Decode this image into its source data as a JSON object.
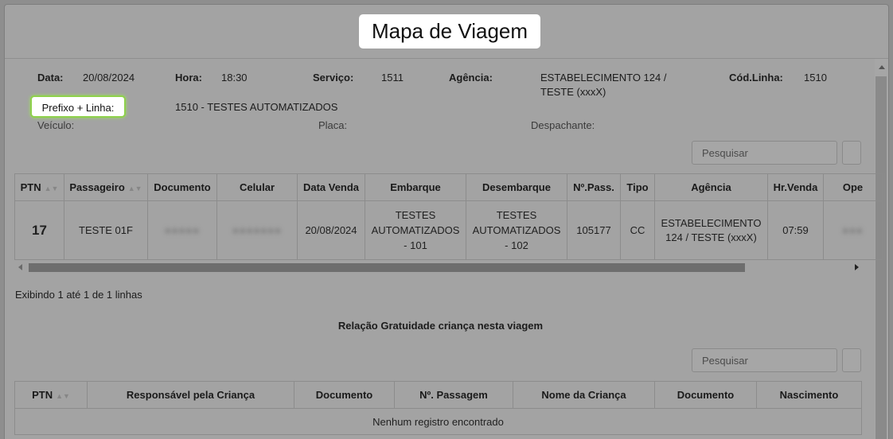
{
  "modal": {
    "title": "Mapa de Viagem"
  },
  "info": {
    "data_label": "Data:",
    "data_value": "20/08/2024",
    "hora_label": "Hora:",
    "hora_value": "18:30",
    "servico_label": "Serviço:",
    "servico_value": "1511",
    "agencia_label": "Agência:",
    "agencia_value_line1": "ESTABELECIMENTO 124 /",
    "agencia_value_line2": "TESTE (xxxX)",
    "codlinha_label": "Cód.Linha:",
    "codlinha_value": "1510",
    "prefixo_label": "Prefixo + Linha:",
    "prefixo_value": "1510 - TESTES AUTOMATIZADOS",
    "veiculo_label": "Veículo:",
    "placa_label": "Placa:",
    "despachante_label": "Despachante:"
  },
  "search": {
    "placeholder": "Pesquisar"
  },
  "passengers": {
    "headers": [
      "PTN",
      "Passageiro",
      "Documento",
      "Celular",
      "Data Venda",
      "Embarque",
      "Desembarque",
      "Nº.Pass.",
      "Tipo",
      "Agência",
      "Hr.Venda",
      "Ope"
    ],
    "rows": [
      {
        "ptn": "17",
        "passageiro": "TESTE 01F",
        "documento": "●●●●●",
        "celular": "●●●●●●●",
        "data_venda": "20/08/2024",
        "embarque_l1": "TESTES",
        "embarque_l2": "AUTOMATIZADOS",
        "embarque_l3": "- 101",
        "desembarque_l1": "TESTES",
        "desembarque_l2": "AUTOMATIZADOS",
        "desembarque_l3": "- 102",
        "n_pass": "105177",
        "tipo": "CC",
        "agencia_l1": "ESTABELECIMENTO",
        "agencia_l2": "124 / TESTE (xxxX)",
        "hr_venda": "07:59",
        "ope": "●●●"
      }
    ],
    "footer": "Exibindo 1 até 1 de 1 linhas"
  },
  "gratuidade": {
    "title": "Relação Gratuidade criança nesta viagem",
    "headers": [
      "PTN",
      "Responsável pela Criança",
      "Documento",
      "Nº. Passagem",
      "Nome da Criança",
      "Documento",
      "Nascimento"
    ],
    "empty": "Nenhum registro encontrado"
  }
}
